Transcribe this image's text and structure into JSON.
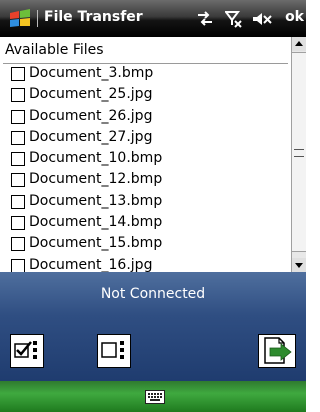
{
  "app": {
    "title": "File Transfer",
    "ok_label": "ok"
  },
  "list": {
    "header": "Available Files",
    "items": [
      "Document_3.bmp",
      "Document_25.jpg",
      "Document_26.jpg",
      "Document_27.jpg",
      "Document_10.bmp",
      "Document_12.bmp",
      "Document_13.bmp",
      "Document_14.bmp",
      "Document_15.bmp",
      "Document_16.jpg"
    ]
  },
  "panel": {
    "status": "Not Connected"
  },
  "icons": {
    "start": "windows-flag-icon",
    "connectivity": "connectivity-icon",
    "signal": "signal-off-icon",
    "volume": "speaker-muted-icon",
    "select_all": "select-all-icon",
    "deselect_all": "deselect-all-icon",
    "transfer": "file-transfer-icon",
    "keyboard": "keyboard-icon"
  },
  "colors": {
    "title_bar": "#1a1a1a",
    "panel": "#2f4e82",
    "bottom_bar": "#3fa93f",
    "transfer_arrow": "#2e8b2e"
  }
}
